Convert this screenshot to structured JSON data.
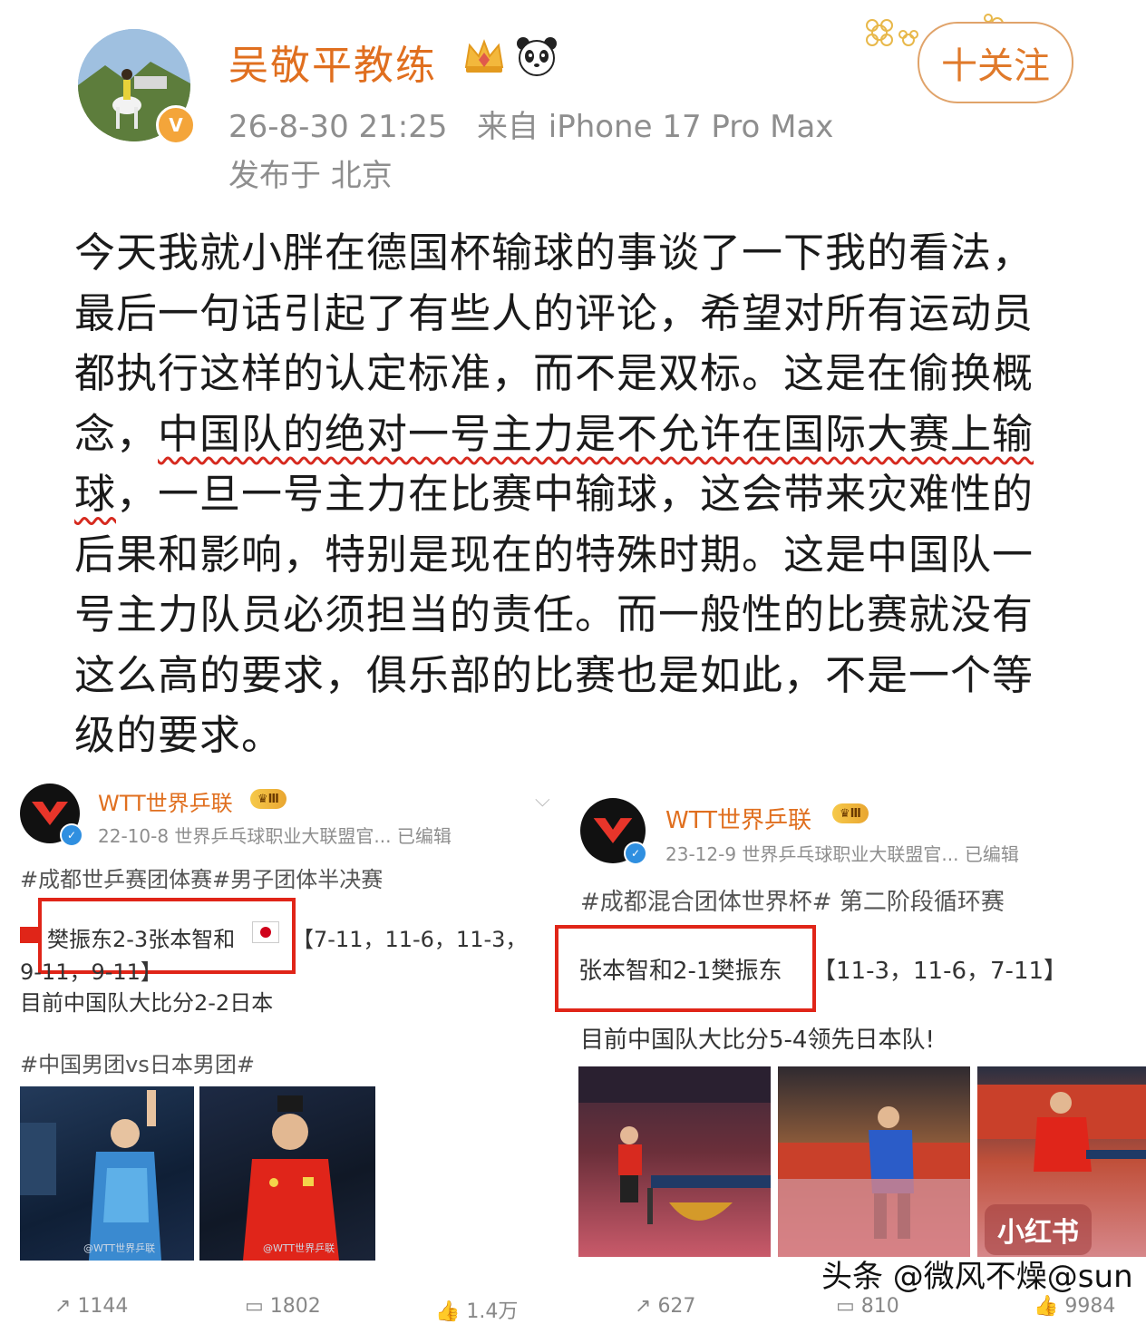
{
  "post": {
    "username": "吴敬平教练",
    "timestamp": "26-8-30 21:25",
    "source": "来自 iPhone 17 Pro Max",
    "location": "发布于 北京",
    "follow_label": "十关注",
    "body_part1": "今天我就小胖在德国杯输球的事谈了一下我的看法，最后一句话引起了有些人的评论，希望对所有运动员都执行这样的认定标准，而不是双标。这是在偷换概念，",
    "body_highlight": "中国队的绝对一号主力是不允许在国际大赛上输球",
    "body_part2": "，一旦一号主力在比赛中输球，这会带来灾难性的后果和影响，特别是现在的特殊时期。这是中国队一号主力队员必须担当的责任。而一般性的比赛就没有这么高的要求，俱乐部的比赛也是如此，不是一个等级的要求。"
  },
  "card_left": {
    "name": "WTT世界乒联",
    "level": "Ⅲ",
    "meta": "22-10-8  世界乒乓球职业大联盟官...  已编辑",
    "hashtag_line": "#成都世乒赛团体赛#男子团体半决赛",
    "boxed_text": "樊振东2-3张本智和",
    "score_line1": "【7-11，11-6，11-3，",
    "score_line2": "9-11，9-11】",
    "summary": "目前中国队大比分2-2日本",
    "tag2": "#中国男团vs日本男团#",
    "photo_caption": "@WTT世界乒联",
    "stats": [
      "1144",
      "1802",
      "1.4万"
    ]
  },
  "card_right": {
    "name": "WTT世界乒联",
    "level": "Ⅲ",
    "meta": "23-12-9  世界乒乓球职业大联盟官...  已编辑",
    "hashtag_line": "#成都混合团体世界杯# 第二阶段循环赛",
    "boxed_text": "张本智和2-1樊振东",
    "score_line": "【11-3，11-6，7-11】",
    "summary": "目前中国队大比分5-4领先日本队!",
    "stats": [
      "627",
      "810",
      "9984"
    ]
  },
  "watermark": "头条 @微风不燥@sun",
  "xhs_logo": "小红书",
  "icons": {
    "follow": "plus-icon",
    "verify": "verified-badge-icon",
    "crown": "crown-icon",
    "panda": "panda-icon",
    "dropdown": "chevron-down-icon"
  },
  "colors": {
    "username": "#e06f1f",
    "highlight": "#d62a1f",
    "box": "#e02518"
  }
}
